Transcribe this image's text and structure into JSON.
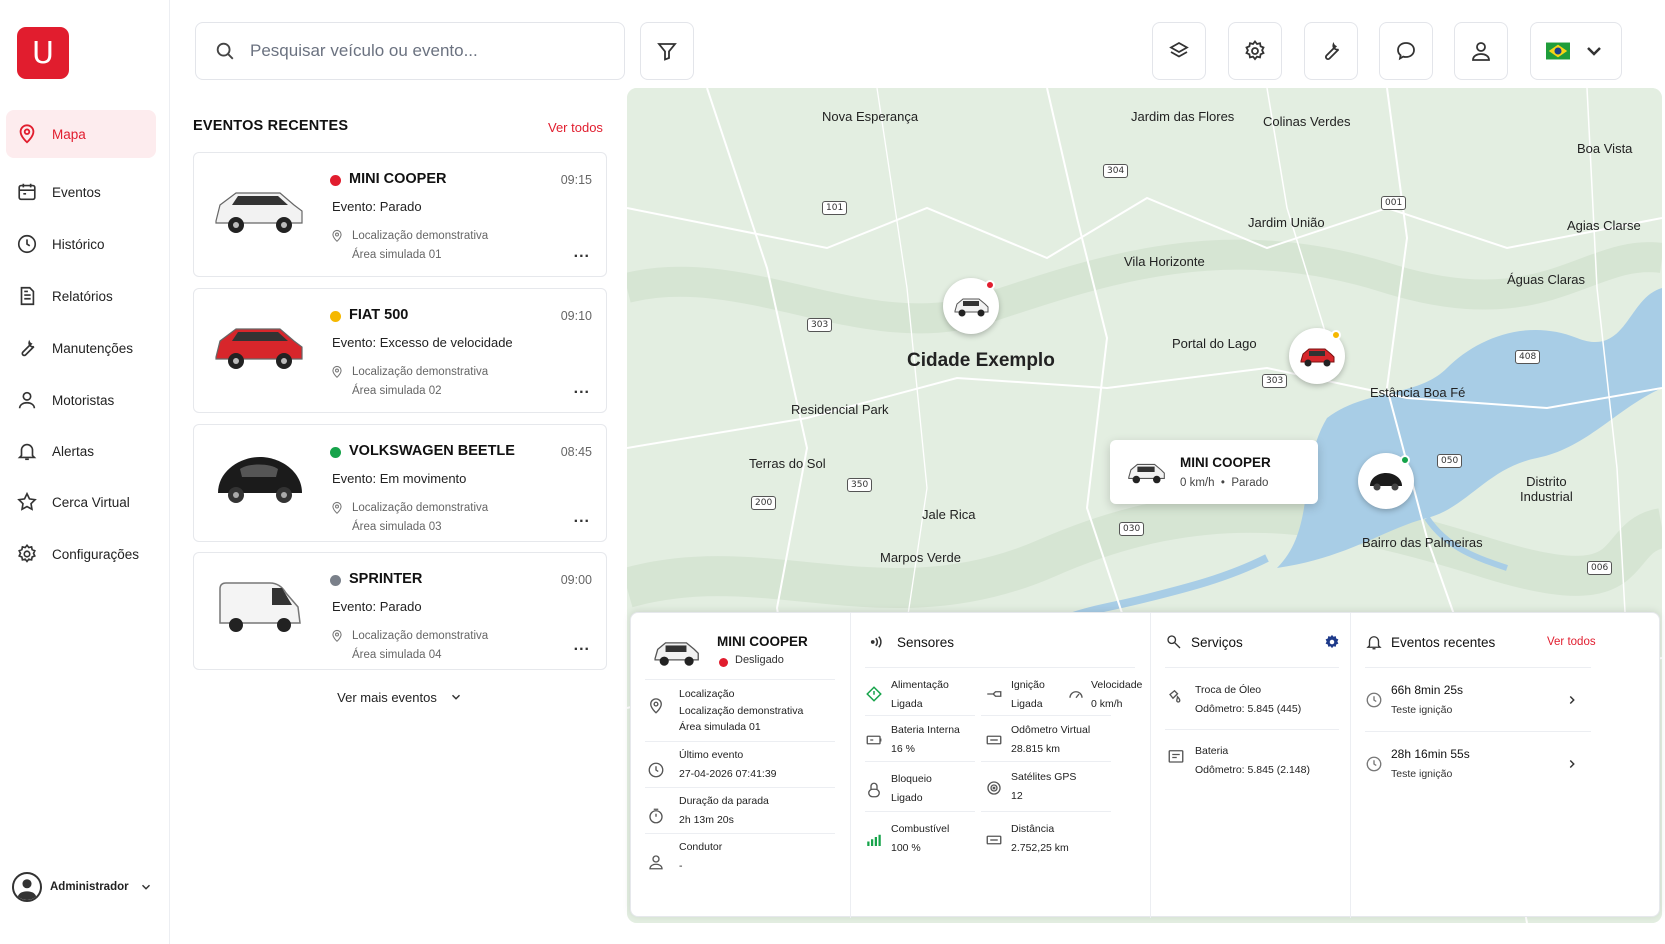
{
  "brand": {
    "logo_letter": "U",
    "color": "#e11d2e"
  },
  "sidebar": {
    "items": [
      {
        "label": "Mapa",
        "icon": "map-pin-icon",
        "active": true
      },
      {
        "label": "Eventos",
        "icon": "calendar-icon"
      },
      {
        "label": "Histórico",
        "icon": "clock-icon"
      },
      {
        "label": "Relatórios",
        "icon": "document-icon"
      },
      {
        "label": "Manutenções",
        "icon": "wrench-icon"
      },
      {
        "label": "Motoristas",
        "icon": "person-icon"
      },
      {
        "label": "Alertas",
        "icon": "bell-icon"
      },
      {
        "label": "Cerca Virtual",
        "icon": "star-icon"
      },
      {
        "label": "Configurações",
        "icon": "gear-icon"
      }
    ],
    "user": "Administrador"
  },
  "header": {
    "search_placeholder": "Pesquisar veículo ou evento...",
    "icons": [
      "filter-icon",
      "layers-icon",
      "gear-icon",
      "wrench-icon",
      "chat-icon",
      "user-icon",
      "brazil-flag-icon"
    ]
  },
  "recent_events": {
    "title": "EVENTOS RECENTES",
    "see_all": "Ver todos",
    "see_more": "Ver mais eventos",
    "items": [
      {
        "name": "MINI COOPER",
        "time": "09:15",
        "event": "Evento: Parado",
        "loc1": "Localização demonstrativa",
        "loc2": "Área simulada 01",
        "status_color": "#e11d2e",
        "car_color": "#f2f2f2"
      },
      {
        "name": "FIAT 500",
        "time": "09:10",
        "event": "Evento: Excesso de velocidade",
        "loc1": "Localização demonstrativa",
        "loc2": "Área simulada 02",
        "status_color": "#f5b800",
        "car_color": "#d7262b"
      },
      {
        "name": "VOLKSWAGEN BEETLE",
        "time": "08:45",
        "event": "Evento: Em movimento",
        "loc1": "Localização demonstrativa",
        "loc2": "Área simulada 03",
        "status_color": "#16a34a",
        "car_color": "#1b1b1b"
      },
      {
        "name": "SPRINTER",
        "time": "09:00",
        "event": "Evento: Parado",
        "loc1": "Localização demonstrativa",
        "loc2": "Área simulada 04",
        "status_color": "#7a808a",
        "car_color": "#f4f4f4"
      }
    ]
  },
  "map": {
    "labels": {
      "nova_esperanca": "Nova Esperança",
      "jardim_flores": "Jardim das Flores",
      "colinas_verdes": "Colinas Verdes",
      "boa_vista": "Boa Vista",
      "jardim_uniao": "Jardim União",
      "agias_clarse": "Agias Clarse",
      "vila_horizonte": "Vila Horizonte",
      "aguas_claras": "Águas Claras",
      "cidade_exemplo": "Cidade Exemplo",
      "portal_lago": "Portal do Lago",
      "estancia": "Estância Boa Fé",
      "residencial": "Residencial Park",
      "terras_sol": "Terras do Sol",
      "distrito": "Distrito",
      "industrial": "Industrial",
      "jale_rica": "Jale Rica",
      "marpos_verde": "Marpos Verde",
      "bairro_palmeiras": "Bairro das Palmeiras"
    },
    "shields": [
      "304",
      "101",
      "001",
      "303",
      "303",
      "408",
      "050",
      "350",
      "200",
      "030",
      "006"
    ],
    "popup": {
      "name": "MINI COOPER",
      "speed": "0 km/h",
      "sep": "•",
      "status": "Parado"
    }
  },
  "panel": {
    "vehicle": {
      "name": "MINI COOPER",
      "status": "Desligado"
    },
    "info": [
      {
        "label": "Localização",
        "value": "Localização demonstrativa",
        "value2": "Área simulada 01"
      },
      {
        "label": "Último evento",
        "value": "27-04-2026 07:41:39"
      },
      {
        "label": "Duração da parada",
        "value": "2h 13m 20s"
      },
      {
        "label": "Condutor",
        "value": "-"
      }
    ],
    "sensors": {
      "title": "Sensores",
      "items": [
        {
          "label": "Alimentação",
          "value": "Ligada"
        },
        {
          "label": "Ignição",
          "value": "Ligada"
        },
        {
          "label": "Velocidade",
          "value": "0 km/h"
        },
        {
          "label": "Bateria Interna",
          "value": "16 %"
        },
        {
          "label": "Odômetro Virtual",
          "value": "28.815 km"
        },
        {
          "label": "Bloqueio",
          "value": "Ligado"
        },
        {
          "label": "Satélites GPS",
          "value": "12"
        },
        {
          "label": "Combustível",
          "value": "100 %"
        },
        {
          "label": "Distância",
          "value": "2.752,25 km"
        }
      ]
    },
    "services": {
      "title": "Serviços",
      "items": [
        {
          "label": "Troca de Óleo",
          "value": "Odômetro: 5.845 (445)"
        },
        {
          "label": "Bateria",
          "value": "Odômetro: 5.845 (2.148)"
        }
      ]
    },
    "events": {
      "title": "Eventos recentes",
      "see_all": "Ver todos",
      "items": [
        {
          "time": "66h 8min 25s",
          "desc": "Teste ignição"
        },
        {
          "time": "28h 16min 55s",
          "desc": "Teste ignição"
        }
      ]
    }
  }
}
